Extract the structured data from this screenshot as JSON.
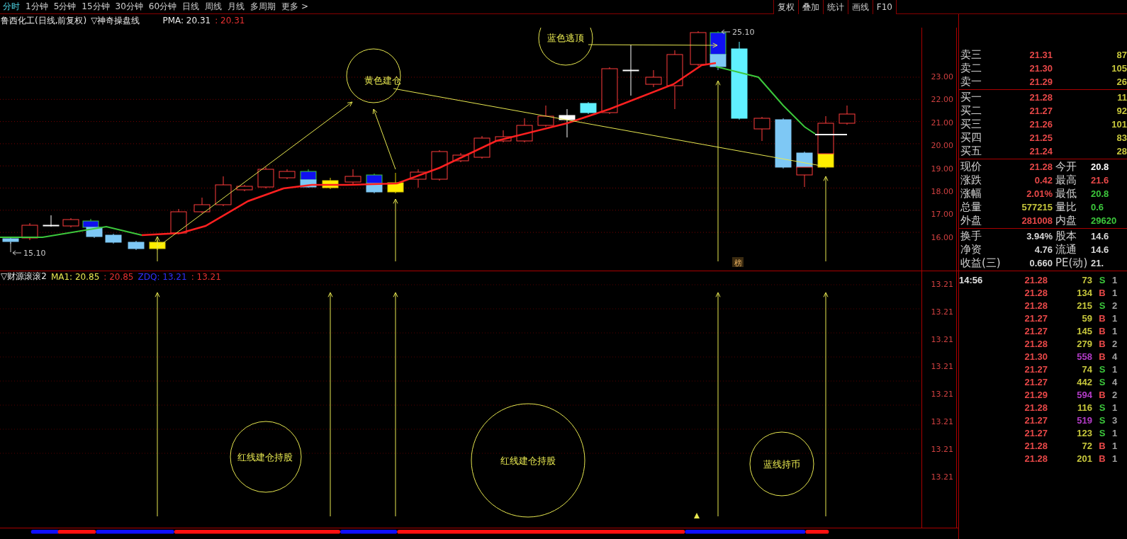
{
  "menu": {
    "tabs": [
      {
        "label": "分时",
        "selected": true
      },
      {
        "label": "1分钟",
        "selected": false
      },
      {
        "label": "5分钟",
        "selected": false
      },
      {
        "label": "15分钟",
        "selected": false
      },
      {
        "label": "30分钟",
        "selected": false
      },
      {
        "label": "60分钟",
        "selected": false
      },
      {
        "label": "日线",
        "selected": false
      },
      {
        "label": "周线",
        "selected": false
      },
      {
        "label": "月线",
        "selected": false
      },
      {
        "label": "多周期",
        "selected": false
      },
      {
        "label": "更多 >",
        "selected": false
      }
    ],
    "buttons": [
      "复权",
      "叠加",
      "统计",
      "画线",
      "F10"
    ]
  },
  "chart_header": {
    "title": "鲁西化工(日线,前复权)",
    "indicator": "▽神奇操盘线",
    "pma_label": "PMA: 20.31",
    "pma_value": ": 20.31"
  },
  "price_axis": [
    "23.00",
    "22.00",
    "21.00",
    "20.00",
    "19.00",
    "18.00",
    "17.00",
    "16.00"
  ],
  "annotations": [
    "黄色建仓",
    "蓝色逃顶"
  ],
  "low_label": "15.10",
  "high_label": "25.10",
  "marker_label": "榜",
  "lower_header": {
    "name": "▽财源滚滚2",
    "ma_label": "MA1: 20.85",
    "ma_value": ": 20.85",
    "zdq_label": "ZDQ: 13.21",
    "zdq_value": ": 13.21"
  },
  "lower_axis": [
    "13.21",
    "13.21",
    "13.21",
    "13.21",
    "13.21",
    "13.21",
    "13.21",
    "13.21"
  ],
  "lower_annotations": [
    "红线建仓持股",
    "红线建仓持股",
    "蓝线持币"
  ],
  "order_book": [
    {
      "label": "卖三",
      "price": "21.31",
      "volume": "87"
    },
    {
      "label": "卖二",
      "price": "21.30",
      "volume": "105"
    },
    {
      "label": "卖一",
      "price": "21.29",
      "volume": "26"
    },
    {
      "label": "买一",
      "price": "21.28",
      "volume": "11"
    },
    {
      "label": "买二",
      "price": "21.27",
      "volume": "92"
    },
    {
      "label": "买三",
      "price": "21.26",
      "volume": "101"
    },
    {
      "label": "买四",
      "price": "21.25",
      "volume": "83"
    },
    {
      "label": "买五",
      "price": "21.24",
      "volume": "28"
    }
  ],
  "quote": [
    {
      "label": "现价",
      "value": "21.28",
      "color": "#e84848"
    },
    {
      "label": "今开",
      "value": "20.8",
      "color": "#ffffff"
    },
    {
      "label": "涨跌",
      "value": "0.42",
      "color": "#e84848"
    },
    {
      "label": "最高",
      "value": "21.6",
      "color": "#e84848"
    },
    {
      "label": "涨幅",
      "value": "2.01%",
      "color": "#e84848"
    },
    {
      "label": "最低",
      "value": "20.8",
      "color": "#3cc83c"
    },
    {
      "label": "总量",
      "value": "577215",
      "color": "#c8c83c"
    },
    {
      "label": "量比",
      "value": "0.6",
      "color": "#3cc83c"
    },
    {
      "label": "外盘",
      "value": "281008",
      "color": "#e84848"
    },
    {
      "label": "内盘",
      "value": "29620",
      "color": "#3cc83c"
    }
  ],
  "fundamentals": [
    {
      "label": "换手",
      "value": "3.94%"
    },
    {
      "label": "股本",
      "value": "14.6"
    },
    {
      "label": "净资",
      "value": "4.76"
    },
    {
      "label": "流通",
      "value": "14.6"
    },
    {
      "label": "收益(三)",
      "value": "0.660"
    },
    {
      "label": "PE(动)",
      "value": "21."
    }
  ],
  "ticks": [
    {
      "time": "14:56",
      "price": "21.28",
      "volume": "73",
      "color": "#c8c83c",
      "side": "S",
      "kind": "sell",
      "column_5": "1"
    },
    {
      "price": "21.28",
      "volume": "134",
      "color": "#c8c83c",
      "side": "B",
      "kind": "buy",
      "column_5": "1"
    },
    {
      "price": "21.28",
      "volume": "215",
      "color": "#c8c83c",
      "side": "S",
      "kind": "sell",
      "column_5": "2"
    },
    {
      "price": "21.27",
      "volume": "59",
      "color": "#c8c83c",
      "side": "B",
      "kind": "buy",
      "column_5": "1"
    },
    {
      "price": "21.27",
      "volume": "145",
      "color": "#c8c83c",
      "side": "B",
      "kind": "buy",
      "column_5": "1"
    },
    {
      "price": "21.28",
      "volume": "279",
      "color": "#c8c83c",
      "side": "B",
      "kind": "buy",
      "column_5": "2"
    },
    {
      "price": "21.30",
      "volume": "558",
      "color": "#b43cc8",
      "side": "B",
      "kind": "buy",
      "column_5": "4"
    },
    {
      "price": "21.27",
      "volume": "74",
      "color": "#c8c83c",
      "side": "S",
      "kind": "sell",
      "column_5": "1"
    },
    {
      "price": "21.27",
      "volume": "442",
      "color": "#c8c83c",
      "side": "S",
      "kind": "sell",
      "column_5": "4"
    },
    {
      "price": "21.29",
      "volume": "594",
      "color": "#b43cc8",
      "side": "B",
      "kind": "buy",
      "column_5": "2"
    },
    {
      "price": "21.28",
      "volume": "116",
      "color": "#c8c83c",
      "side": "S",
      "kind": "sell",
      "column_5": "1"
    },
    {
      "price": "21.27",
      "volume": "519",
      "color": "#b43cc8",
      "side": "S",
      "kind": "sell",
      "column_5": "3"
    },
    {
      "price": "21.27",
      "volume": "123",
      "color": "#c8c83c",
      "side": "S",
      "kind": "sell",
      "column_5": "1"
    },
    {
      "price": "21.28",
      "volume": "72",
      "color": "#c8c83c",
      "side": "B",
      "kind": "buy",
      "column_5": "1"
    },
    {
      "price": "21.28",
      "volume": "201",
      "color": "#c8c83c",
      "side": "B",
      "kind": "buy",
      "column_5": "1"
    }
  ]
}
